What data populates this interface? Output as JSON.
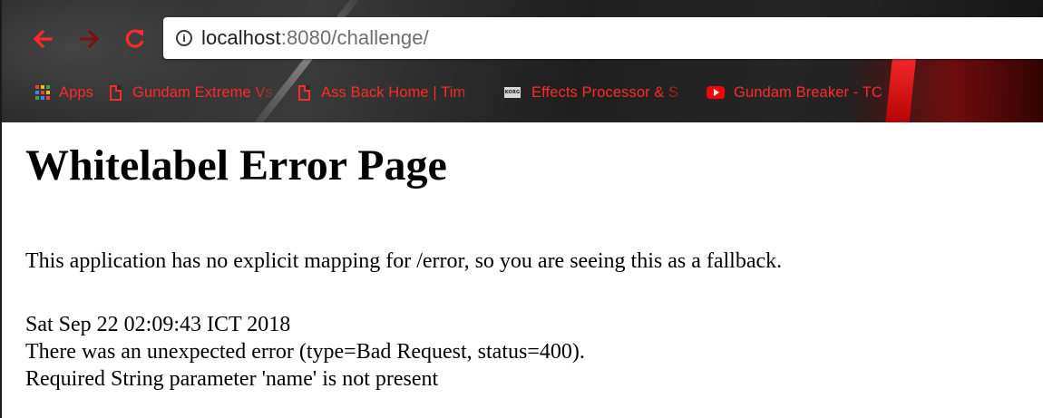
{
  "browser": {
    "url_host": "localhost",
    "url_rest": ":8080/challenge/",
    "colors": {
      "accent_red": "#ff2a2a"
    },
    "nav_icons": [
      "back-arrow-icon",
      "forward-arrow-icon",
      "reload-icon",
      "info-icon"
    ]
  },
  "bookmarks": {
    "items": [
      {
        "label": "Apps",
        "icon": "apps-grid-icon"
      },
      {
        "label": "Gundam Extreme Vs",
        "icon": "page-icon"
      },
      {
        "label": "Ass Back Home | Tim",
        "icon": "page-icon"
      },
      {
        "label": "Effects Processor & S",
        "icon": "korg-icon"
      },
      {
        "label": "Gundam Breaker - TC",
        "icon": "youtube-icon"
      }
    ]
  },
  "page": {
    "title": "Whitelabel Error Page",
    "message": "This application has no explicit mapping for /error, so you are seeing this as a fallback.",
    "timestamp": "Sat Sep 22 02:09:43 ICT 2018",
    "error_line": "There was an unexpected error (type=Bad Request, status=400).",
    "detail": "Required String parameter 'name' is not present"
  }
}
